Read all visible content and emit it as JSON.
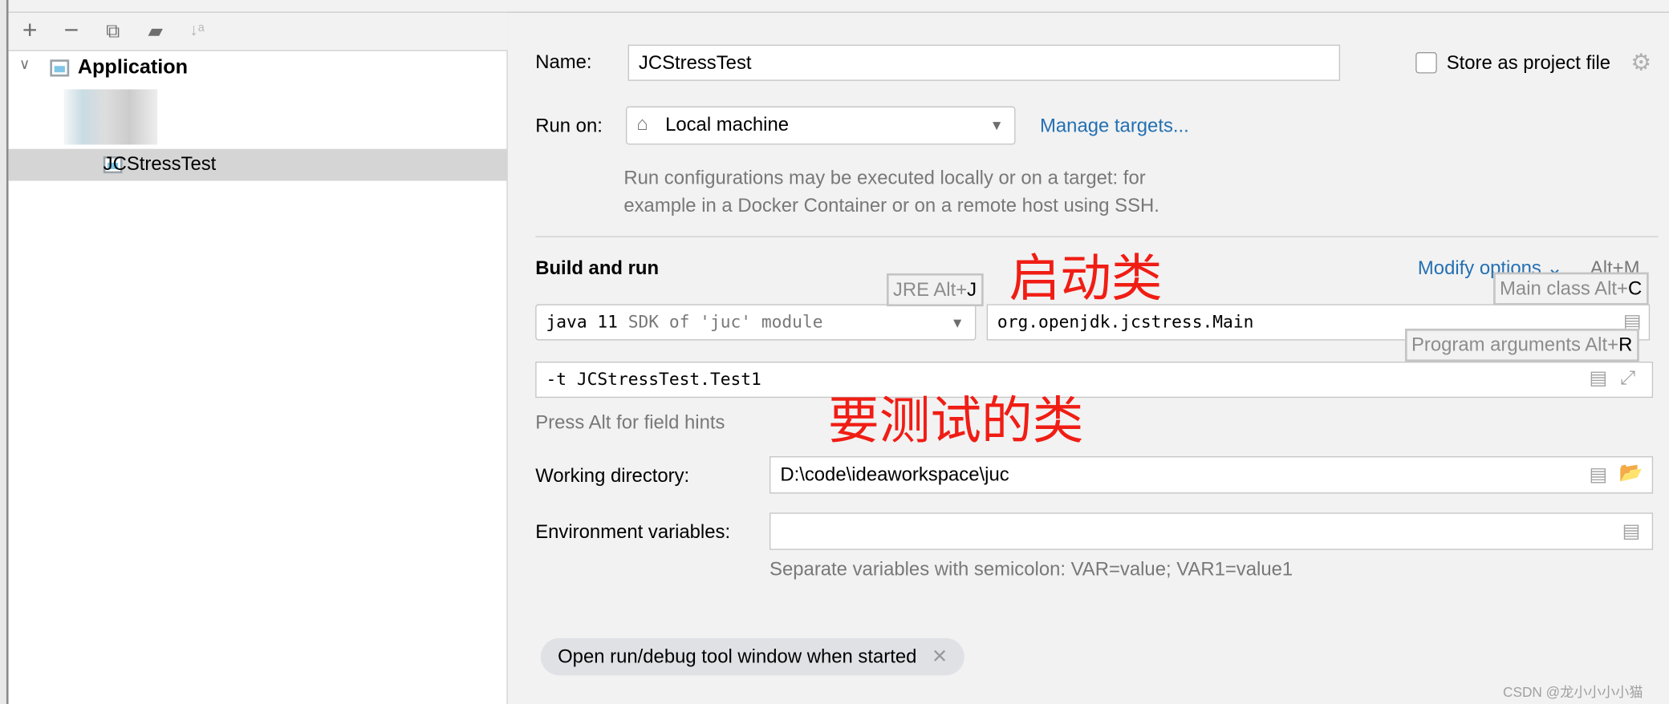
{
  "toolbar": {
    "add": "+",
    "remove": "−",
    "copy": "copy-icon",
    "folder": "new-folder-icon",
    "sort": "sort-icon"
  },
  "tree": {
    "group": "Application",
    "selected": "JCStressTest"
  },
  "form": {
    "name_label": "Name:",
    "name_value": "JCStressTest",
    "store_label": "Store as project file",
    "run_on_label": "Run on:",
    "run_on_value": "Local machine",
    "manage_targets": "Manage targets...",
    "run_desc_1": "Run configurations may be executed locally or on a target: for",
    "run_desc_2": "example in a Docker Container or on a remote host using SSH.",
    "build_run": "Build and run",
    "modify_options": "Modify options",
    "modify_shortcut": "Alt+M",
    "jre_value": "java 11",
    "jre_hint": "SDK of 'juc' module",
    "main_class": "org.openjdk.jcstress.Main",
    "program_args": "-t JCStressTest.Test1",
    "field_hints": "Press Alt for field hints",
    "workdir_label": "Working directory:",
    "workdir_value": "D:\\code\\ideaworkspace\\juc",
    "env_label": "Environment variables:",
    "env_value": "",
    "env_hint": "Separate variables with semicolon: VAR=value; VAR1=value1",
    "chip": "Open run/debug tool window when started"
  },
  "tooltips": {
    "jre": "JRE Alt+",
    "jre_key": "J",
    "main": "Main class Alt+",
    "main_key": "C",
    "args": "Program arguments Alt+",
    "args_key": "R"
  },
  "annotations": {
    "main_class": "启动类",
    "test_class": "要测试的类"
  },
  "watermark": "CSDN @龙小小小小猫",
  "colors": {
    "link": "#2470b3",
    "annotation": "#f01d14",
    "selection": "#d5d5d5"
  }
}
